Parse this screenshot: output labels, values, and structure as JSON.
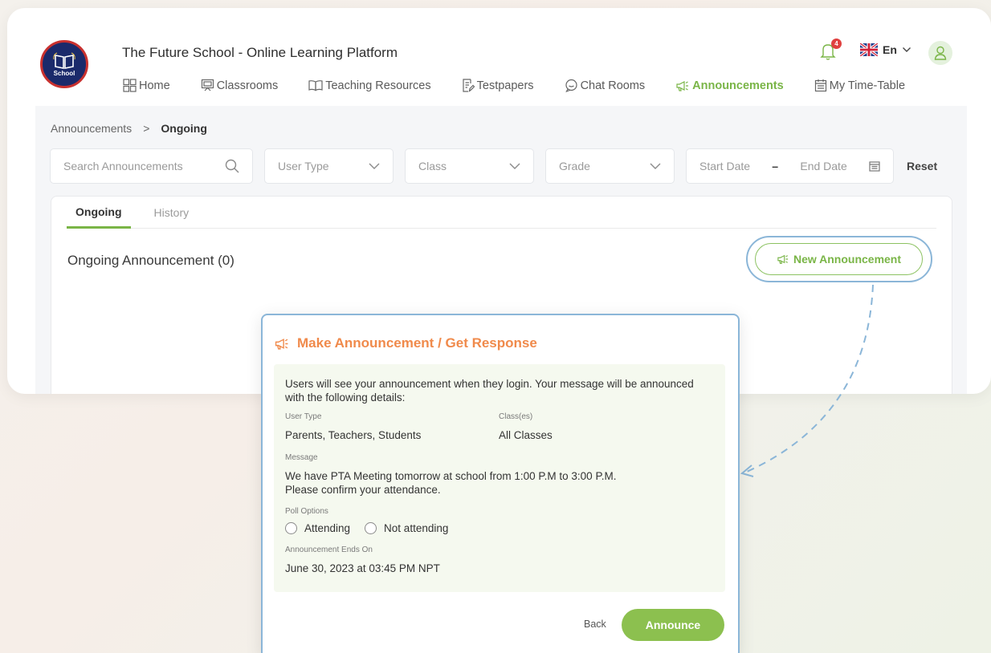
{
  "app": {
    "title": "The Future School - Online Learning Platform",
    "logo_text": "School",
    "notifications_count": "4",
    "language": "En"
  },
  "nav": {
    "items": [
      {
        "label": "Home",
        "icon": "grid-icon"
      },
      {
        "label": "Classrooms",
        "icon": "presentation-icon"
      },
      {
        "label": "Teaching Resources",
        "icon": "book-icon"
      },
      {
        "label": "Testpapers",
        "icon": "document-edit-icon"
      },
      {
        "label": "Chat Rooms",
        "icon": "chat-bubble-icon"
      },
      {
        "label": "Announcements",
        "icon": "megaphone-icon"
      },
      {
        "label": "My Time-Table",
        "icon": "calendar-icon"
      }
    ],
    "active": "Announcements"
  },
  "breadcrumb": {
    "root": "Announcements",
    "separator": ">",
    "current": "Ongoing"
  },
  "filters": {
    "search_placeholder": "Search Announcements",
    "user_type": "User Type",
    "class": "Class",
    "grade": "Grade",
    "start_date": "Start Date",
    "date_separator": "–",
    "end_date": "End Date",
    "reset": "Reset"
  },
  "tabs": {
    "ongoing": "Ongoing",
    "history": "History"
  },
  "section": {
    "title": "Ongoing Announcement (0)",
    "new_button": "New Announcement"
  },
  "modal": {
    "title": "Make Announcement / Get Response",
    "intro": "Users will see your announcement when they login. Your message will be announced with the following details:",
    "user_type_label": "User Type",
    "user_type_value": "Parents, Teachers, Students",
    "classes_label": "Class(es)",
    "classes_value": "All Classes",
    "message_label": "Message",
    "message_line1": "We have PTA Meeting tomorrow at school from 1:00 P.M to 3:00 P.M.",
    "message_line2": "Please confirm your attendance.",
    "poll_label": "Poll Options",
    "poll_options": [
      "Attending",
      "Not attending"
    ],
    "ends_label": "Announcement Ends On",
    "ends_value": "June 30, 2023 at 03:45 PM NPT",
    "back": "Back",
    "announce": "Announce"
  },
  "colors": {
    "accent_green": "#7ab547",
    "announce_button": "#8cc04f",
    "modal_title_orange": "#f08a4b",
    "highlight_blue": "#8bb6d8",
    "details_bg": "#f5f9ef"
  }
}
